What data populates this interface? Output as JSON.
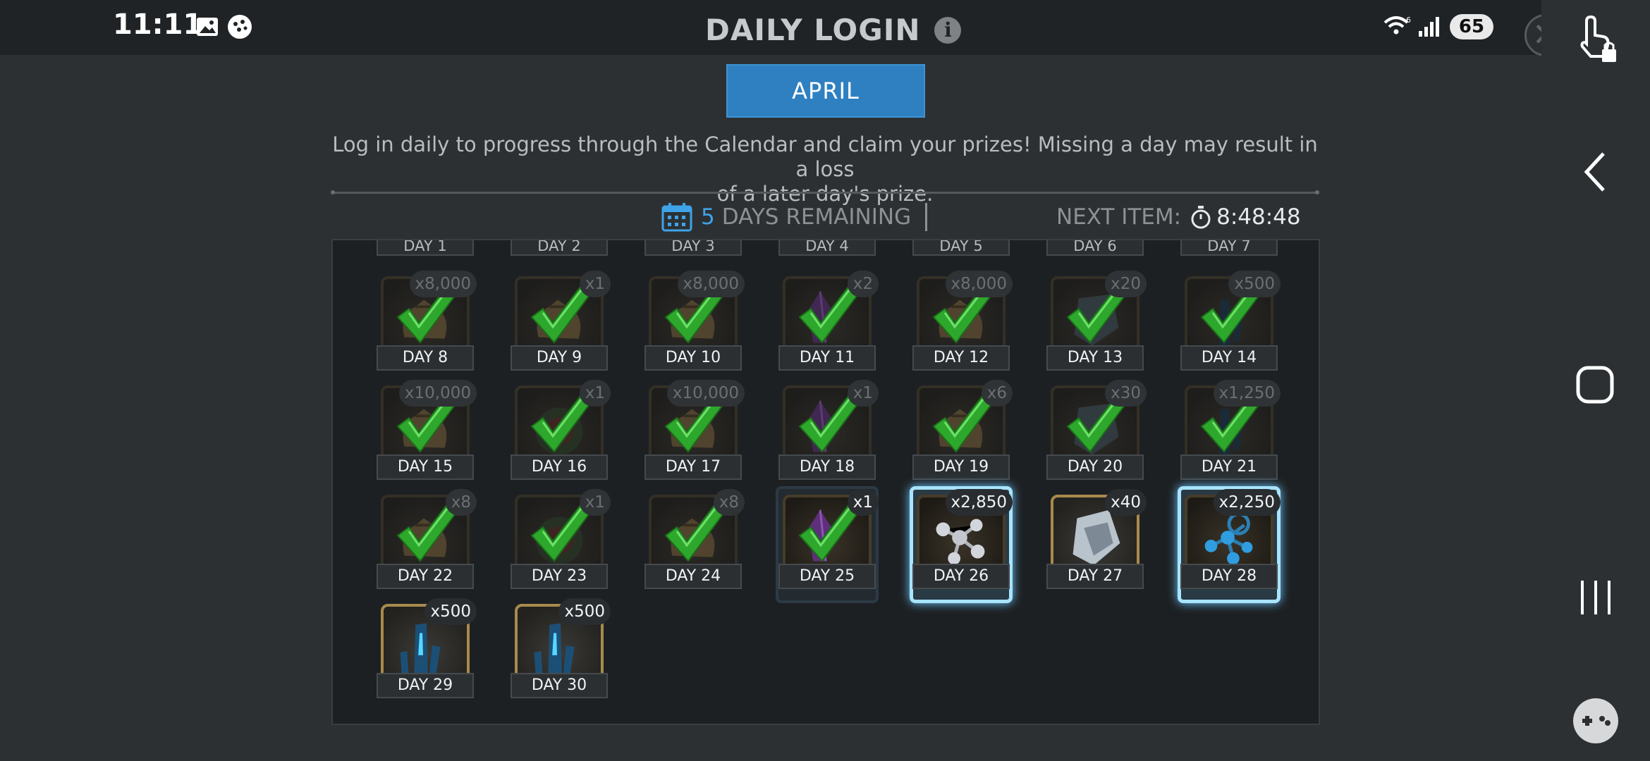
{
  "status_bar": {
    "time": "11:11",
    "battery": "65"
  },
  "header": {
    "title": "DAILY LOGIN",
    "info_glyph": "i",
    "close_glyph": "✕"
  },
  "month_button": "APRIL",
  "description_line1": "Log in daily to progress through the Calendar and claim your prizes! Missing a day may result in a loss",
  "description_line2": "of a later day's prize.",
  "remaining": {
    "count": "5",
    "label": "DAYS REMAINING"
  },
  "next_item": {
    "label": "NEXT ITEM:",
    "time": "8:48:48"
  },
  "top_row": [
    "DAY 1",
    "DAY 2",
    "DAY 3",
    "DAY 4",
    "DAY 5",
    "DAY 6",
    "DAY 7"
  ],
  "days": [
    {
      "label": "DAY 8",
      "qty": "x8,000",
      "state": "done",
      "item": "bag"
    },
    {
      "label": "DAY 9",
      "qty": "x1",
      "state": "done",
      "item": "bag"
    },
    {
      "label": "DAY 10",
      "qty": "x8,000",
      "state": "done",
      "item": "bag"
    },
    {
      "label": "DAY 11",
      "qty": "x2",
      "state": "done",
      "item": "crystal-purple"
    },
    {
      "label": "DAY 12",
      "qty": "x8,000",
      "state": "done",
      "item": "bag"
    },
    {
      "label": "DAY 13",
      "qty": "x20",
      "state": "done",
      "item": "armor"
    },
    {
      "label": "DAY 14",
      "qty": "x500",
      "state": "done",
      "item": "shard"
    },
    {
      "label": "DAY 15",
      "qty": "x10,000",
      "state": "done",
      "item": "bag"
    },
    {
      "label": "DAY 16",
      "qty": "x1",
      "state": "done",
      "item": "orb-green"
    },
    {
      "label": "DAY 17",
      "qty": "x10,000",
      "state": "done",
      "item": "bag"
    },
    {
      "label": "DAY 18",
      "qty": "x1",
      "state": "done",
      "item": "crystal-purple"
    },
    {
      "label": "DAY 19",
      "qty": "x6",
      "state": "done",
      "item": "bag"
    },
    {
      "label": "DAY 20",
      "qty": "x30",
      "state": "done",
      "item": "armor"
    },
    {
      "label": "DAY 21",
      "qty": "x1,250",
      "state": "done",
      "item": "shard"
    },
    {
      "label": "DAY 22",
      "qty": "x8",
      "state": "done",
      "item": "bag"
    },
    {
      "label": "DAY 23",
      "qty": "x1",
      "state": "done",
      "item": "orb-green"
    },
    {
      "label": "DAY 24",
      "qty": "x8",
      "state": "done",
      "item": "bag"
    },
    {
      "label": "DAY 25",
      "qty": "x1",
      "state": "today",
      "item": "crystal-purple"
    },
    {
      "label": "DAY 26",
      "qty": "x2,850",
      "state": "current",
      "item": "molecule"
    },
    {
      "label": "DAY 27",
      "qty": "x40",
      "state": "active",
      "item": "armor-silver"
    },
    {
      "label": "DAY 28",
      "qty": "x2,250",
      "state": "current",
      "item": "molecule-blue"
    },
    {
      "label": "DAY 29",
      "qty": "x500",
      "state": "active",
      "item": "shard-blue"
    },
    {
      "label": "DAY 30",
      "qty": "x500",
      "state": "active",
      "item": "shard-blue"
    }
  ],
  "colors": {
    "accent_blue": "#2f80c1",
    "highlight": "#a8e4ff",
    "check_green": "#2ea82c"
  }
}
